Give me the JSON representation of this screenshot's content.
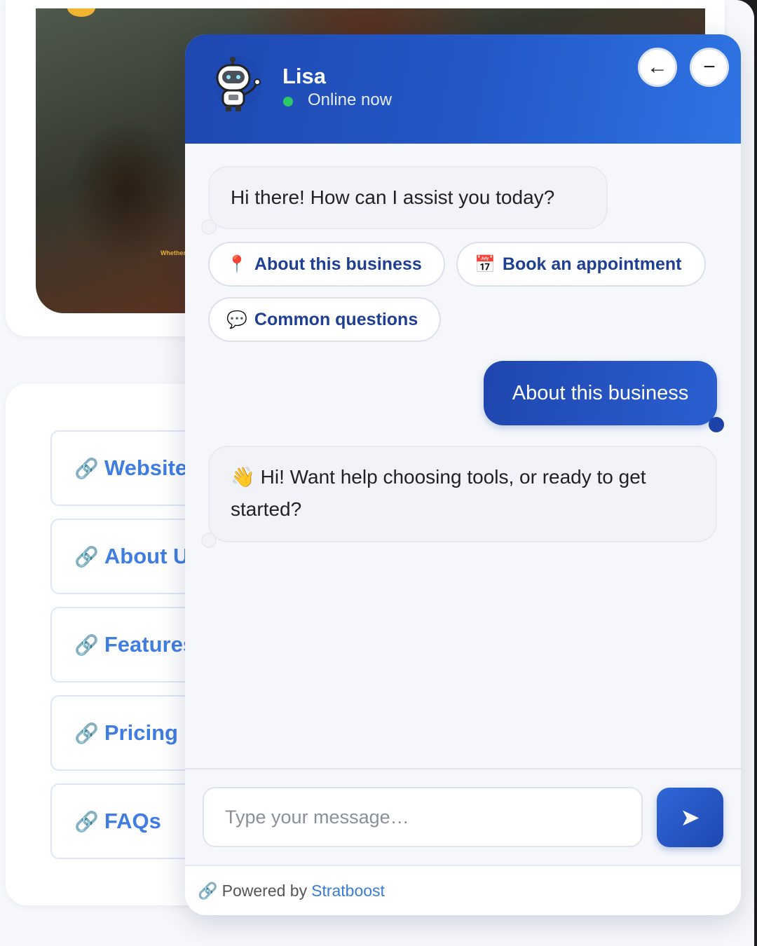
{
  "background": {
    "hero_caption": "Whether y",
    "links": [
      {
        "icon": "link-icon",
        "label": "Website"
      },
      {
        "icon": "link-icon",
        "label": "About U"
      },
      {
        "icon": "link-icon",
        "label": "Features"
      },
      {
        "icon": "link-icon",
        "label": "Pricing"
      },
      {
        "icon": "link-icon",
        "label": "FAQs"
      }
    ]
  },
  "chat": {
    "agent_name": "Lisa",
    "status": "Online now",
    "header_buttons": {
      "back": "←",
      "minimize": "−"
    },
    "messages": {
      "greeting": "Hi there! How can I assist you today?",
      "user_reply": "About this business",
      "followup": "👋 Hi! Want help choosing tools, or ready to get started?"
    },
    "quick_replies": [
      {
        "icon": "📍",
        "label": "About this business"
      },
      {
        "icon": "📅",
        "label": "Book an appointment"
      },
      {
        "icon": "💬",
        "label": "Common questions"
      }
    ],
    "input": {
      "placeholder": "Type your message…"
    },
    "send_label": "➤",
    "footer": {
      "prefix": "Powered by",
      "brand": "Stratboost",
      "icon": "🔗"
    }
  },
  "colors": {
    "header_start": "#1f48b0",
    "header_end": "#2f74e4",
    "chip_text": "#1f3f93",
    "link_text": "#3f7de0",
    "online": "#2ec866"
  }
}
